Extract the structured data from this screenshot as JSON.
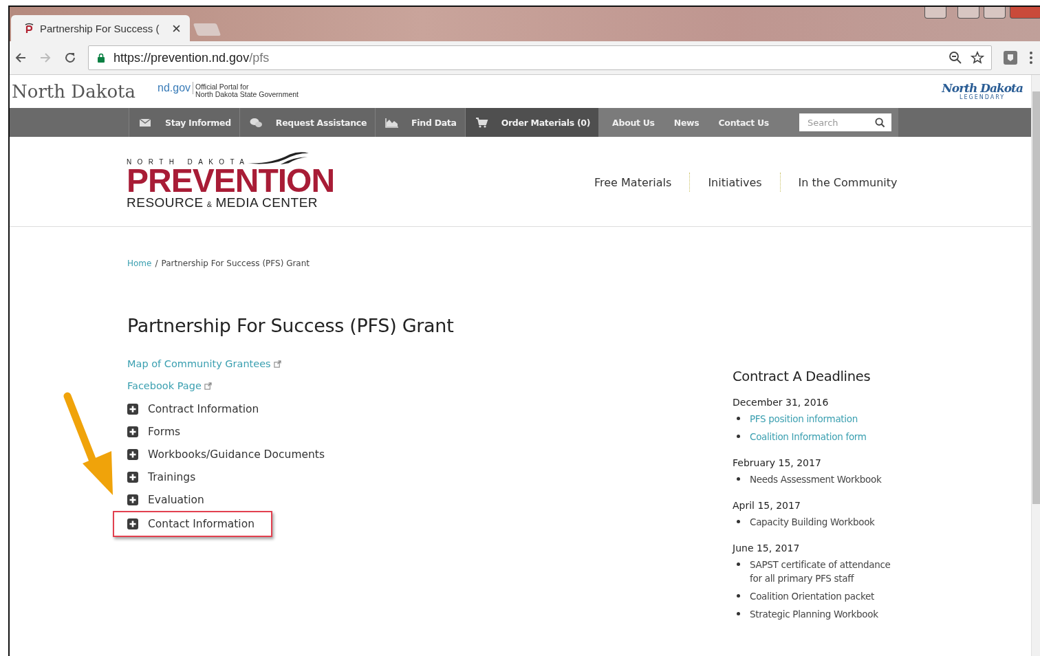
{
  "browser": {
    "tab_title": "Partnership For Success (",
    "url_host": "https://prevention.nd.gov",
    "url_path": "/pfs"
  },
  "portal_header": {
    "state_name": "North Dakota",
    "portal_brand": "nd.gov",
    "portal_line_1": "Official Portal for",
    "portal_line_2": "North Dakota State Government",
    "legendary_logo": "North Dakota",
    "legendary_tagline": "LEGENDARY"
  },
  "utility_nav": {
    "primary": [
      {
        "label": "Stay Informed",
        "selected": false
      },
      {
        "label": "Request Assistance",
        "selected": false
      },
      {
        "label": "Find Data",
        "selected": false
      },
      {
        "label": "Order Materials (0)",
        "selected": true
      }
    ],
    "secondary": [
      {
        "label": "About Us"
      },
      {
        "label": "News"
      },
      {
        "label": "Contact Us"
      }
    ],
    "search": {
      "placeholder": "Search"
    }
  },
  "site_logo": {
    "top": "NORTH DAKOTA",
    "main": "PREVENTION",
    "bottom_left": "RESOURCE",
    "bottom_amp": "&",
    "bottom_right": "MEDIA CENTER"
  },
  "main_nav": [
    {
      "label": "Free Materials"
    },
    {
      "label": "Initiatives"
    },
    {
      "label": "In the Community"
    }
  ],
  "breadcrumb": {
    "separator": "/",
    "items": [
      {
        "label": "Home",
        "link": true
      },
      {
        "label": "Partnership For Success (PFS) Grant",
        "link": false
      }
    ]
  },
  "page_title": "Partnership For Success (PFS) Grant",
  "external_links": [
    {
      "label": "Map of Community Grantees"
    },
    {
      "label": "Facebook Page"
    }
  ],
  "sections": [
    {
      "label": "Contract Information",
      "expanded": false,
      "highlighted": false
    },
    {
      "label": "Forms",
      "expanded": false,
      "highlighted": false
    },
    {
      "label": "Workbooks/Guidance Documents",
      "expanded": false,
      "highlighted": false
    },
    {
      "label": "Trainings",
      "expanded": false,
      "highlighted": false
    },
    {
      "label": "Evaluation",
      "expanded": false,
      "highlighted": false
    },
    {
      "label": "Contact Information",
      "expanded": false,
      "highlighted": true
    }
  ],
  "deadlines": {
    "title": "Contract A Deadlines",
    "groups": [
      {
        "date": "December 31, 2016",
        "items": [
          {
            "text": "PFS position information",
            "link": true
          },
          {
            "text": "Coalition Information form",
            "link": true
          }
        ]
      },
      {
        "date": "February 15, 2017",
        "items": [
          {
            "text": "Needs Assessment Workbook",
            "link": false
          }
        ]
      },
      {
        "date": "April 15, 2017",
        "items": [
          {
            "text": "Capacity Building Workbook",
            "link": false
          }
        ]
      },
      {
        "date": "June 15, 2017",
        "items": [
          {
            "text": "SAPST certificate of attendance for all primary PFS staff",
            "link": false
          },
          {
            "text": "Coalition Orientation packet",
            "link": false
          },
          {
            "text": "Strategic Planning Workbook",
            "link": false
          }
        ]
      }
    ]
  }
}
